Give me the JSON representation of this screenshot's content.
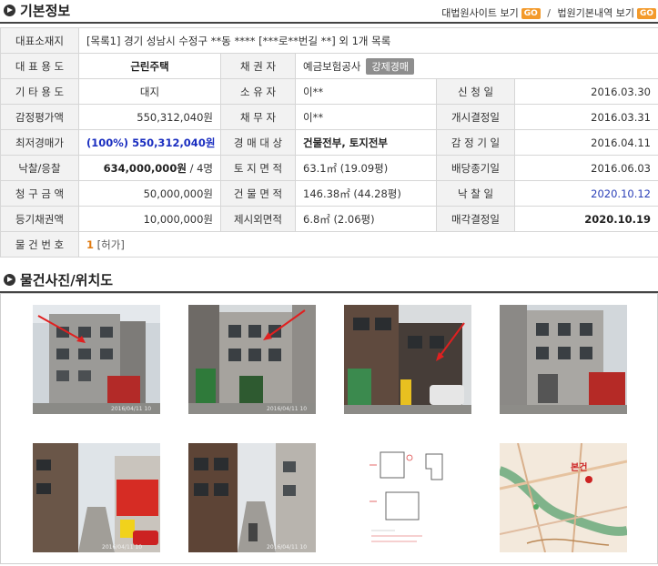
{
  "basic": {
    "title": "기본정보",
    "links": [
      {
        "label": "대법원사이트 보기",
        "go": "GO"
      },
      {
        "label": "법원기본내역 보기",
        "go": "GO"
      }
    ],
    "link_sep": "/",
    "address_label": "대표소재지",
    "address_value": "[목록1] 경기 성남시 수정구 **동 **** [***로**번길 **] 외 1개 목록",
    "rows": {
      "use_label": "대 표 용 도",
      "use_value": "근린주택",
      "creditor_label": "채 권 자",
      "creditor_value": "예금보험공사",
      "creditor_badge": "강제경매",
      "other_use_label": "기 타 용 도",
      "other_use_value": "대지",
      "owner_label": "소 유 자",
      "owner_value": "이**",
      "apply_label": "신 청 일",
      "apply_value": "2016.03.30",
      "appraisal_label": "감정평가액",
      "appraisal_value": "550,312,040원",
      "debtor_label": "채 무 자",
      "debtor_value": "이**",
      "start_label": "개시결정일",
      "start_value": "2016.03.31",
      "min_label": "최저경매가",
      "min_pct": "(100%)",
      "min_value": "550,312,040원",
      "target_label": "경 매 대 상",
      "target_value": "건물전부, 토지전부",
      "appraisal_date_label": "감 정 기 일",
      "appraisal_date_value": "2016.04.11",
      "winbid_label": "낙찰/응찰",
      "winbid_value": "634,000,000원",
      "winbid_count": "/ 4명",
      "land_label": "토 지 면 적",
      "land_value": "63.1㎡ (19.09평)",
      "dividend_label": "배당종기일",
      "dividend_value": "2016.06.03",
      "claim_label": "청 구 금 액",
      "claim_value": "50,000,000원",
      "building_label": "건 물 면 적",
      "building_value": "146.38㎡ (44.28평)",
      "bid_date_label": "낙 찰 일",
      "bid_date_value": "2020.10.12",
      "reg_claim_label": "등기채권액",
      "reg_claim_value": "10,000,000원",
      "excluded_label": "제시외면적",
      "excluded_value": "6.8㎡ (2.06평)",
      "sale_decision_label": "매각결정일",
      "sale_decision_value": "2020.10.19",
      "item_no_label": "물 건 번 호",
      "item_no_value": "1",
      "item_no_status": "[허가]"
    }
  },
  "photos": {
    "title": "물건사진/위치도",
    "stamp": "2016/04/11 10",
    "map_label": "본건"
  },
  "colors": {
    "accent_orange": "#f39a2b",
    "link_blue": "#2a3fb8",
    "label_bg": "#f2f2f2"
  }
}
